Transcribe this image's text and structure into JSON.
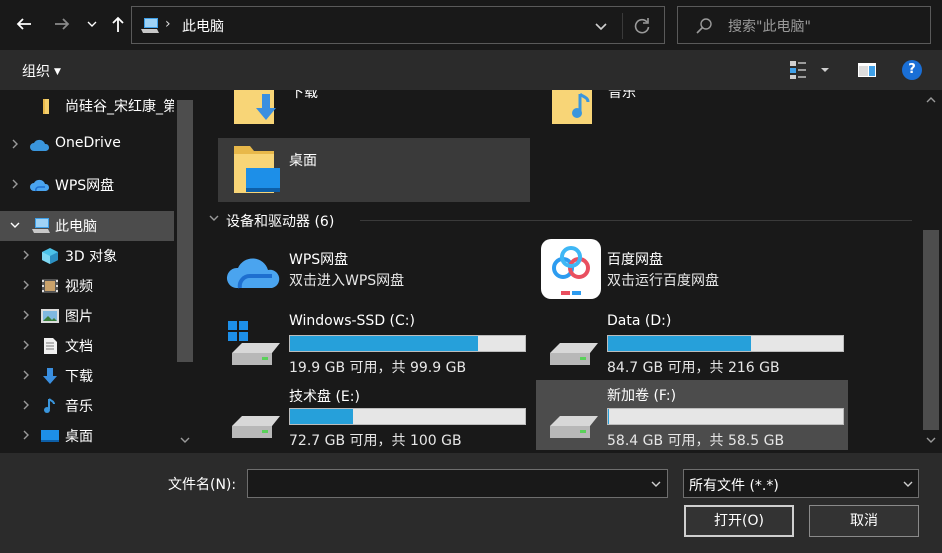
{
  "address": {
    "location": "此电脑",
    "search_placeholder": "搜索\"此电脑\""
  },
  "toolbar": {
    "organize_label": "组织"
  },
  "nav_pane": {
    "items": [
      {
        "label": "尚硅谷_宋红康_第",
        "icon": "folder-icon",
        "selected": false
      },
      {
        "label": "OneDrive",
        "icon": "onedrive-cloud-icon",
        "selected": false
      },
      {
        "label": "WPS网盘",
        "icon": "wps-cloud-icon",
        "selected": false
      },
      {
        "label": "此电脑",
        "icon": "computer-icon",
        "selected": true
      },
      {
        "label": "3D 对象",
        "icon": "3d-objects-icon",
        "selected": false
      },
      {
        "label": "视频",
        "icon": "video-icon",
        "selected": false
      },
      {
        "label": "图片",
        "icon": "pictures-icon",
        "selected": false
      },
      {
        "label": "文档",
        "icon": "documents-icon",
        "selected": false
      },
      {
        "label": "下载",
        "icon": "download-icon",
        "selected": false
      },
      {
        "label": "音乐",
        "icon": "music-icon",
        "selected": false
      },
      {
        "label": "桌面",
        "icon": "desktop-icon",
        "selected": false
      }
    ]
  },
  "content": {
    "folders": [
      {
        "label": "下载",
        "icon": "download-folder-icon"
      },
      {
        "label": "音乐",
        "icon": "music-folder-icon"
      },
      {
        "label": "桌面",
        "icon": "desktop-folder-icon"
      }
    ],
    "group_title": "设备和驱动器 (6)",
    "cloud_drives": [
      {
        "name": "WPS网盘",
        "subtitle": "双击进入WPS网盘",
        "icon": "wps-cloud-icon"
      },
      {
        "name": "百度网盘",
        "subtitle": "双击运行百度网盘",
        "icon": "baidu-netdisk-icon"
      }
    ],
    "drives": [
      {
        "name": "Windows-SSD (C:)",
        "size": "19.9 GB 可用，共 99.9 GB",
        "used_fraction": 0.8,
        "icon": "system-drive-icon",
        "selected": false
      },
      {
        "name": "Data (D:)",
        "size": "84.7 GB 可用，共 216 GB",
        "used_fraction": 0.61,
        "icon": "hard-drive-icon",
        "selected": false
      },
      {
        "name": "技术盘 (E:)",
        "size": "72.7 GB 可用，共 100 GB",
        "used_fraction": 0.27,
        "icon": "hard-drive-icon",
        "selected": false
      },
      {
        "name": "新加卷 (F:)",
        "size": "58.4 GB 可用，共 58.5 GB",
        "used_fraction": 0.002,
        "icon": "hard-drive-icon",
        "selected": true
      }
    ]
  },
  "footer": {
    "filename_label": "文件名(N):",
    "filename_value": "",
    "filetype_value": "所有文件 (*.*)",
    "open_label": "打开(O)",
    "cancel_label": "取消"
  },
  "colors": {
    "background": "#191919",
    "toolbar": "#2b2b2b",
    "selection": "#4c4c4c",
    "progress_fill": "#26a0da",
    "help": "#1a6fd6"
  }
}
